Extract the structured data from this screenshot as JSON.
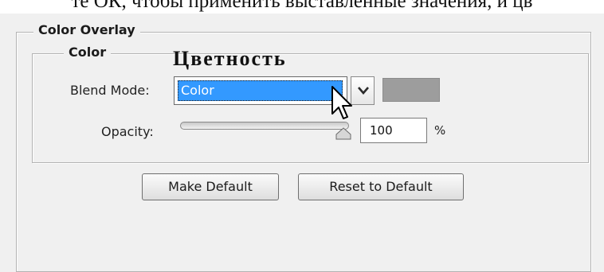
{
  "caption": "те ОК, чтобы применить выставленные значения, и цв",
  "panel": {
    "title": "Color Overlay",
    "section_title": "Color",
    "annotation": "Цветность"
  },
  "blend": {
    "label": "Blend Mode:",
    "selected": "Color",
    "swatch_color": "#9d9d9d"
  },
  "opacity": {
    "label": "Opacity:",
    "value": "100",
    "unit": "%",
    "level": 1.0
  },
  "buttons": {
    "make_default": "Make Default",
    "reset_default": "Reset to Default"
  },
  "icons": {
    "dropdown": "chevron-down-icon",
    "cursor": "cursor-arrow-icon"
  }
}
